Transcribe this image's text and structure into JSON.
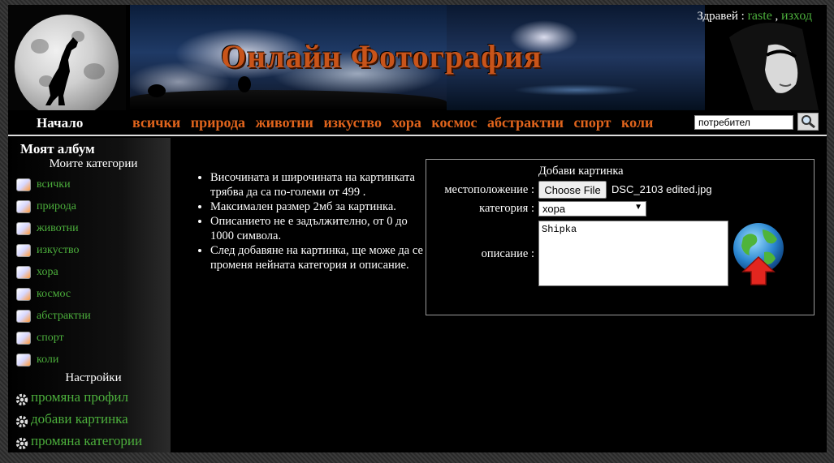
{
  "header": {
    "site_title": "Онлайн Фотография",
    "greeting": "Здравей :",
    "username": "raste",
    "separator": ",",
    "logout": "изход"
  },
  "nav": {
    "home": "Начало",
    "categories": [
      "всички",
      "природа",
      "животни",
      "изкуство",
      "хора",
      "космос",
      "абстрактни",
      "спорт",
      "коли"
    ],
    "search_value": "потребител",
    "search_icon": "magnifier-icon"
  },
  "sidebar": {
    "title": "Моят албум",
    "categories_title": "Моите категории",
    "categories": [
      "всички",
      "природа",
      "животни",
      "изкуство",
      "хора",
      "космос",
      "абстрактни",
      "спорт",
      "коли"
    ],
    "settings_title": "Настройки",
    "settings": [
      "промяна профил",
      "добави картинка",
      "промяна категории"
    ]
  },
  "rules": [
    "Височината и широчината на картинката трябва да са по-големи от 499 .",
    "Максимален размер 2мб за картинка.",
    "Описанието не е задължително, от 0 до 1000 символа.",
    "След добавяне на картинка, ще може да се променя нейната категория и описание."
  ],
  "form": {
    "title": "Добави картинка",
    "location_label": "местоположение :",
    "file_button": "Choose File",
    "file_name": "DSC_2103 edited.jpg",
    "category_label": "категория :",
    "category_value": "хора",
    "description_label": "описание :",
    "description_value": "Shipka",
    "upload_icon": "globe-upload-icon"
  },
  "colors": {
    "link_green": "#4caf3c",
    "nav_orange": "#e0641c",
    "title_orange": "#c8541a"
  }
}
